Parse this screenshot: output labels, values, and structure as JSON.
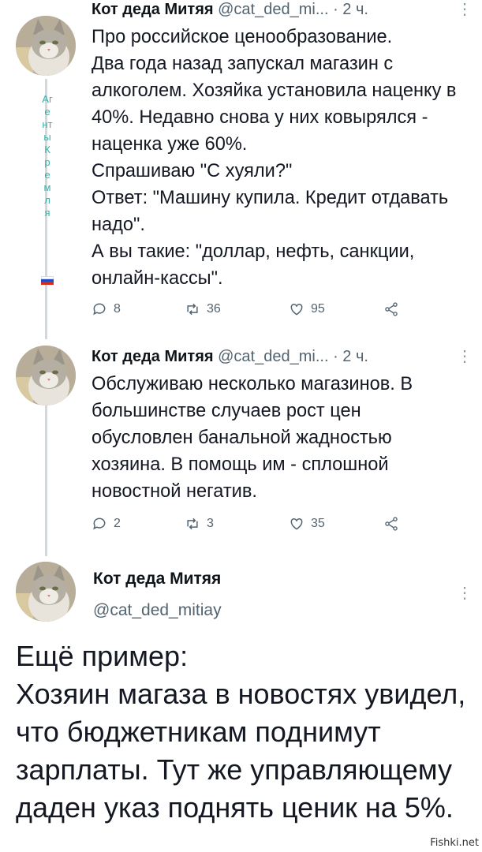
{
  "watermark": "АгентыКремля",
  "tweets": [
    {
      "name": "Кот деда Митяя",
      "handle": "@cat_ded_mi...",
      "time": "· 2 ч.",
      "text": "Про российское ценообразование.\nДва года назад запускал магазин с алкоголем. Хозяйка установила наценку в 40%. Недавно снова у них ковырялся - наценка уже 60%.\nСпрашиваю \"С хуяли?\"\nОтвет: \"Машину купила. Кредит отдавать надо\".\nА вы такие: \"доллар, нефть, санкции, онлайн-кассы\".",
      "replies": "8",
      "retweets": "36",
      "likes": "95"
    },
    {
      "name": "Кот деда Митяя",
      "handle": "@cat_ded_mi...",
      "time": "· 2 ч.",
      "text": "Обслуживаю несколько магазинов. В большинстве случаев рост цен обусловлен банальной жадностью хозяина. В помощь им - сплошной новостной негатив.",
      "replies": "2",
      "retweets": "3",
      "likes": "35"
    }
  ],
  "main": {
    "name": "Кот деда Митяя",
    "handle": "@cat_ded_mitiay",
    "text": "Ещё пример:\nХозяин магаза в новостях увидел, что бюджетникам поднимут зарплаты. Тут же управляющему даден указ поднять ценик на 5%."
  },
  "site_watermark": "Fishki.net",
  "colors": {
    "text": "#141823",
    "muted": "#536471",
    "watermark": "#35b3a6"
  },
  "icons": [
    "reply-icon",
    "retweet-icon",
    "like-icon",
    "share-icon",
    "more-icon"
  ]
}
